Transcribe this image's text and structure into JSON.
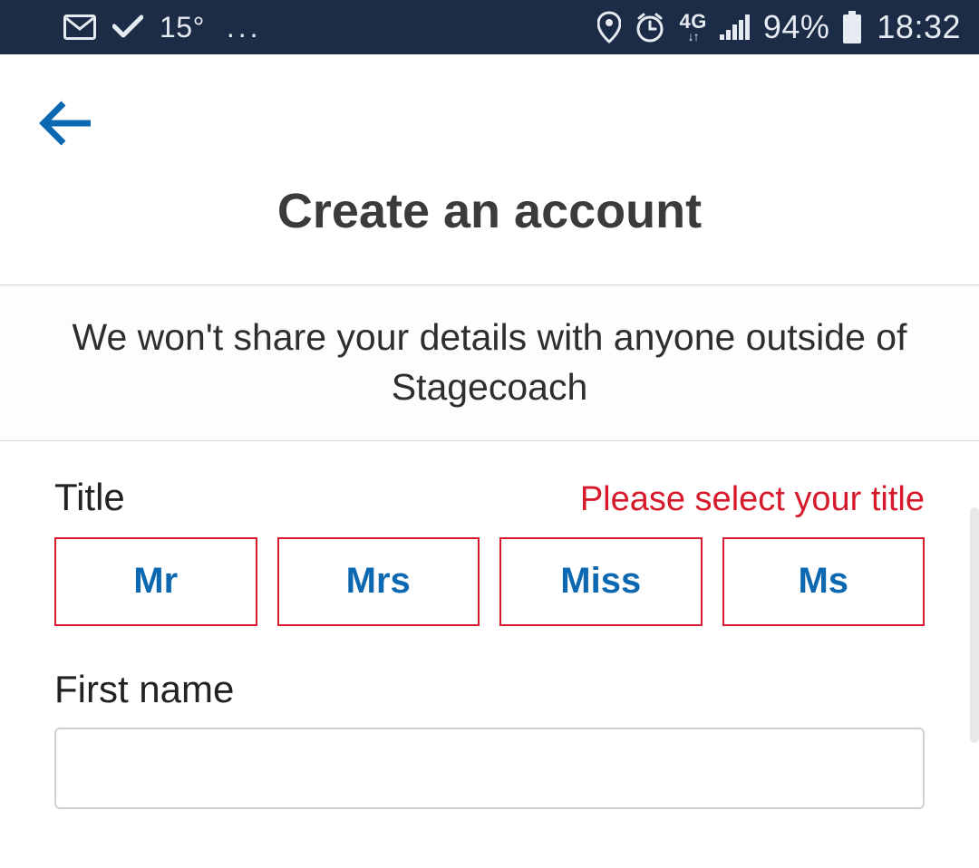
{
  "status_bar": {
    "temperature": "15°",
    "more_dots": "...",
    "network_label": "4G",
    "battery_percent": "94%",
    "clock": "18:32"
  },
  "header": {
    "title": "Create an account"
  },
  "info_banner": "We won't share your details with anyone outside of Stagecoach",
  "form": {
    "title": {
      "label": "Title",
      "error": "Please select your title",
      "options": [
        "Mr",
        "Mrs",
        "Miss",
        "Ms"
      ]
    },
    "first_name": {
      "label": "First name",
      "value": ""
    }
  }
}
